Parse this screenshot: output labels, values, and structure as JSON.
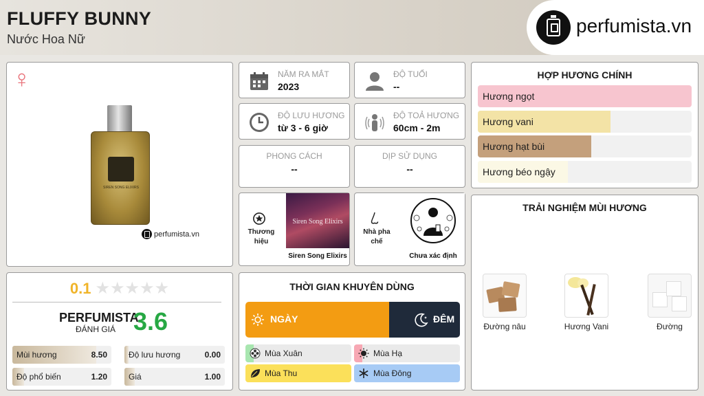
{
  "header": {
    "title": "FLUFFY BUNNY",
    "subtitle": "Nước Hoa Nữ",
    "brand": "perfumista.vn"
  },
  "product": {
    "gender_icon": "female-symbol-icon",
    "watermark": "perfumista.vn",
    "bottle_label": "SIREN SONG ELIXIRS"
  },
  "info": {
    "release_year": {
      "label": "Năm ra mắt",
      "value": "2023",
      "icon": "calendar-icon"
    },
    "age": {
      "label": "Độ tuổi",
      "value": "--",
      "icon": "person-icon"
    },
    "longevity": {
      "label": "Độ lưu hương",
      "value": "từ 3 - 6 giờ",
      "icon": "clock-icon"
    },
    "sillage": {
      "label": "Độ toả hương",
      "value": "60cm - 2m",
      "icon": "sillage-person-icon"
    },
    "style": {
      "label": "Phong cách",
      "value": "--"
    },
    "occasion": {
      "label": "Dịp sử dụng",
      "value": "--"
    },
    "brand": {
      "label": "Thương hiệu",
      "value": "Siren Song Elixirs",
      "image_text": "Siren Song Elixirs"
    },
    "perfumer": {
      "label": "Nhà pha chế",
      "value": "Chưa xác định"
    }
  },
  "accords": {
    "title": "Hợp hương chính",
    "items": [
      {
        "label": "Hương ngọt",
        "percent": 100,
        "color": "#f7c5cf"
      },
      {
        "label": "Hương vani",
        "percent": 62,
        "color": "#f3e3a6"
      },
      {
        "label": "Hương hạt bùi",
        "percent": 53,
        "color": "#c4a07c"
      },
      {
        "label": "Hương béo ngậy",
        "percent": 42,
        "color": "#fbf8e5"
      }
    ]
  },
  "notes": {
    "title": "Trải nghiệm mùi hương",
    "items": [
      {
        "name": "Đường nâu"
      },
      {
        "name": "Hương Vani"
      },
      {
        "name": "Đường"
      }
    ]
  },
  "rating": {
    "user_score": "0.1",
    "stars_filled": 0,
    "stars_total": 5,
    "pf_name": "PERFUMISTA",
    "pf_sub": "ĐÁNH GIÁ",
    "pf_score": "3.6",
    "metrics": [
      {
        "label": "Mùi hương",
        "value": "8.50",
        "fill": 0.85
      },
      {
        "label": "Độ lưu hương",
        "value": "0.00",
        "fill": 0.0
      },
      {
        "label": "Độ phổ biến",
        "value": "1.20",
        "fill": 0.12
      },
      {
        "label": "Giá",
        "value": "1.00",
        "fill": 0.1
      }
    ]
  },
  "time_of_use": {
    "title": "Thời gian khuyên dùng",
    "day_label": "NGÀY",
    "night_label": "ĐÊM",
    "day_share": 0.67,
    "seasons": [
      {
        "label": "Mùa Xuân",
        "fill": 0.08,
        "color": "#a8e6b0",
        "icon": "flower-icon"
      },
      {
        "label": "Mùa Hạ",
        "fill": 0.08,
        "color": "#f7a8b4",
        "icon": "sun-icon"
      },
      {
        "label": "Mùa Thu",
        "fill": 1.0,
        "color": "#fbe05a",
        "icon": "leaf-icon"
      },
      {
        "label": "Mùa Đông",
        "fill": 1.0,
        "color": "#a7cbf5",
        "icon": "snowflake-icon"
      }
    ]
  }
}
